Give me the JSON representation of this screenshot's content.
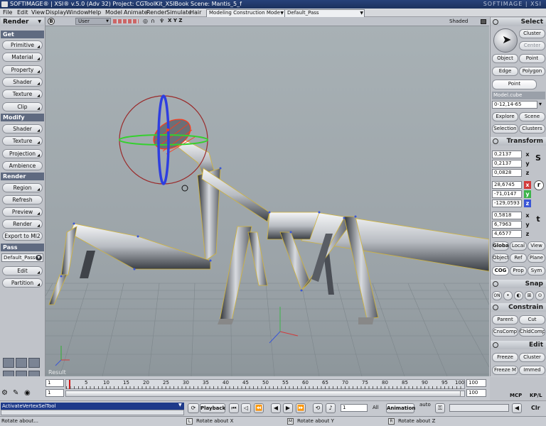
{
  "titlebar": {
    "text": "SOFTIMAGE® | XSI® v.5.0 (Adv 32) Project: CGToolKit_XSIBook   Scene: Mantis_5_f",
    "brand": "SOFTIMAGE | XSI"
  },
  "menubar": {
    "items": [
      "File",
      "Edit",
      "View",
      "Display",
      "Window",
      "Help",
      "Model",
      "Animate",
      "Render",
      "Simulate",
      "Hair"
    ],
    "mode": "Modeling Construction Mode",
    "pass": "Default_Pass"
  },
  "left": {
    "header_render": "Render",
    "get": "Get",
    "get_items": [
      "Primitive",
      "Material",
      "Property",
      "Shader",
      "Texture",
      "Clip"
    ],
    "modify": "Modify",
    "modify_items": [
      "Shader",
      "Texture",
      "Projection",
      "Ambience"
    ],
    "render": "Render",
    "render_items": [
      "Region",
      "Refresh",
      "Preview",
      "Render",
      "Export to MI2"
    ],
    "pass": "Pass",
    "pass_value": "Default_Pass",
    "pass_items": [
      "Edit",
      "Partition"
    ]
  },
  "viewport": {
    "letter": "B",
    "camera": "User",
    "axes": "X Y Z",
    "shading": "Shaded",
    "result": "Result"
  },
  "right": {
    "select": "Select",
    "cluster": "Cluster",
    "center": "Center",
    "object": "Object",
    "point": "Point",
    "edge": "Edge",
    "polygon": "Polygon",
    "point_active": "Point",
    "model": "Model.cube",
    "range": "0-12,14-65",
    "explore": "Explore",
    "scene": "Scene",
    "selection": "Selection",
    "clusters": "Clusters",
    "transform": "Transform",
    "scale": [
      "0,2137",
      "0,2137",
      "0,0828"
    ],
    "rotate": [
      "28,6745",
      "-71,0147",
      "-129,0593"
    ],
    "translate": [
      "0,5818",
      "6,7963",
      "4,6577"
    ],
    "axes": [
      "x",
      "y",
      "z"
    ],
    "global": "Global",
    "local": "Local",
    "view": "View",
    "object2": "Object",
    "ref": "Ref",
    "plane": "Plane",
    "cog": "COG",
    "prop": "Prop",
    "sym": "Sym",
    "snap": "Snap",
    "on": "ON",
    "constrain": "Constrain",
    "parent": "Parent",
    "cut": "Cut",
    "cnscomp": "CnsComp",
    "chldcomp": "ChldComp",
    "edit": "Edit",
    "freeze": "Freeze",
    "cluster2": "Cluster",
    "freezem": "Freeze M",
    "immed": "Immed"
  },
  "timeline": {
    "start1": "1",
    "start2": "1",
    "end1": "100",
    "end2": "100",
    "ticks": [
      "5",
      "10",
      "15",
      "20",
      "25",
      "30",
      "35",
      "40",
      "45",
      "50",
      "55",
      "60",
      "65",
      "70",
      "75",
      "80",
      "85",
      "90",
      "95"
    ],
    "end_tick": "100",
    "mcp": "MCP",
    "kpl": "KP/L"
  },
  "cmd": {
    "input": "ActivateVertexSelTool",
    "playback": "Playback",
    "frame": "1",
    "all": "All",
    "animation": "Animation",
    "auto": "auto",
    "clr": "Clr"
  },
  "status": {
    "main": "Rotate about...",
    "l": "Rotate about X",
    "m": "Rotate about Y",
    "r": "Rotate about Z"
  },
  "colors": {
    "title": "#1c325e",
    "accent_x": "#d23a3a",
    "accent_y": "#3cb44a",
    "accent_z": "#3a56d6",
    "viewport": "#9ea7ac"
  }
}
